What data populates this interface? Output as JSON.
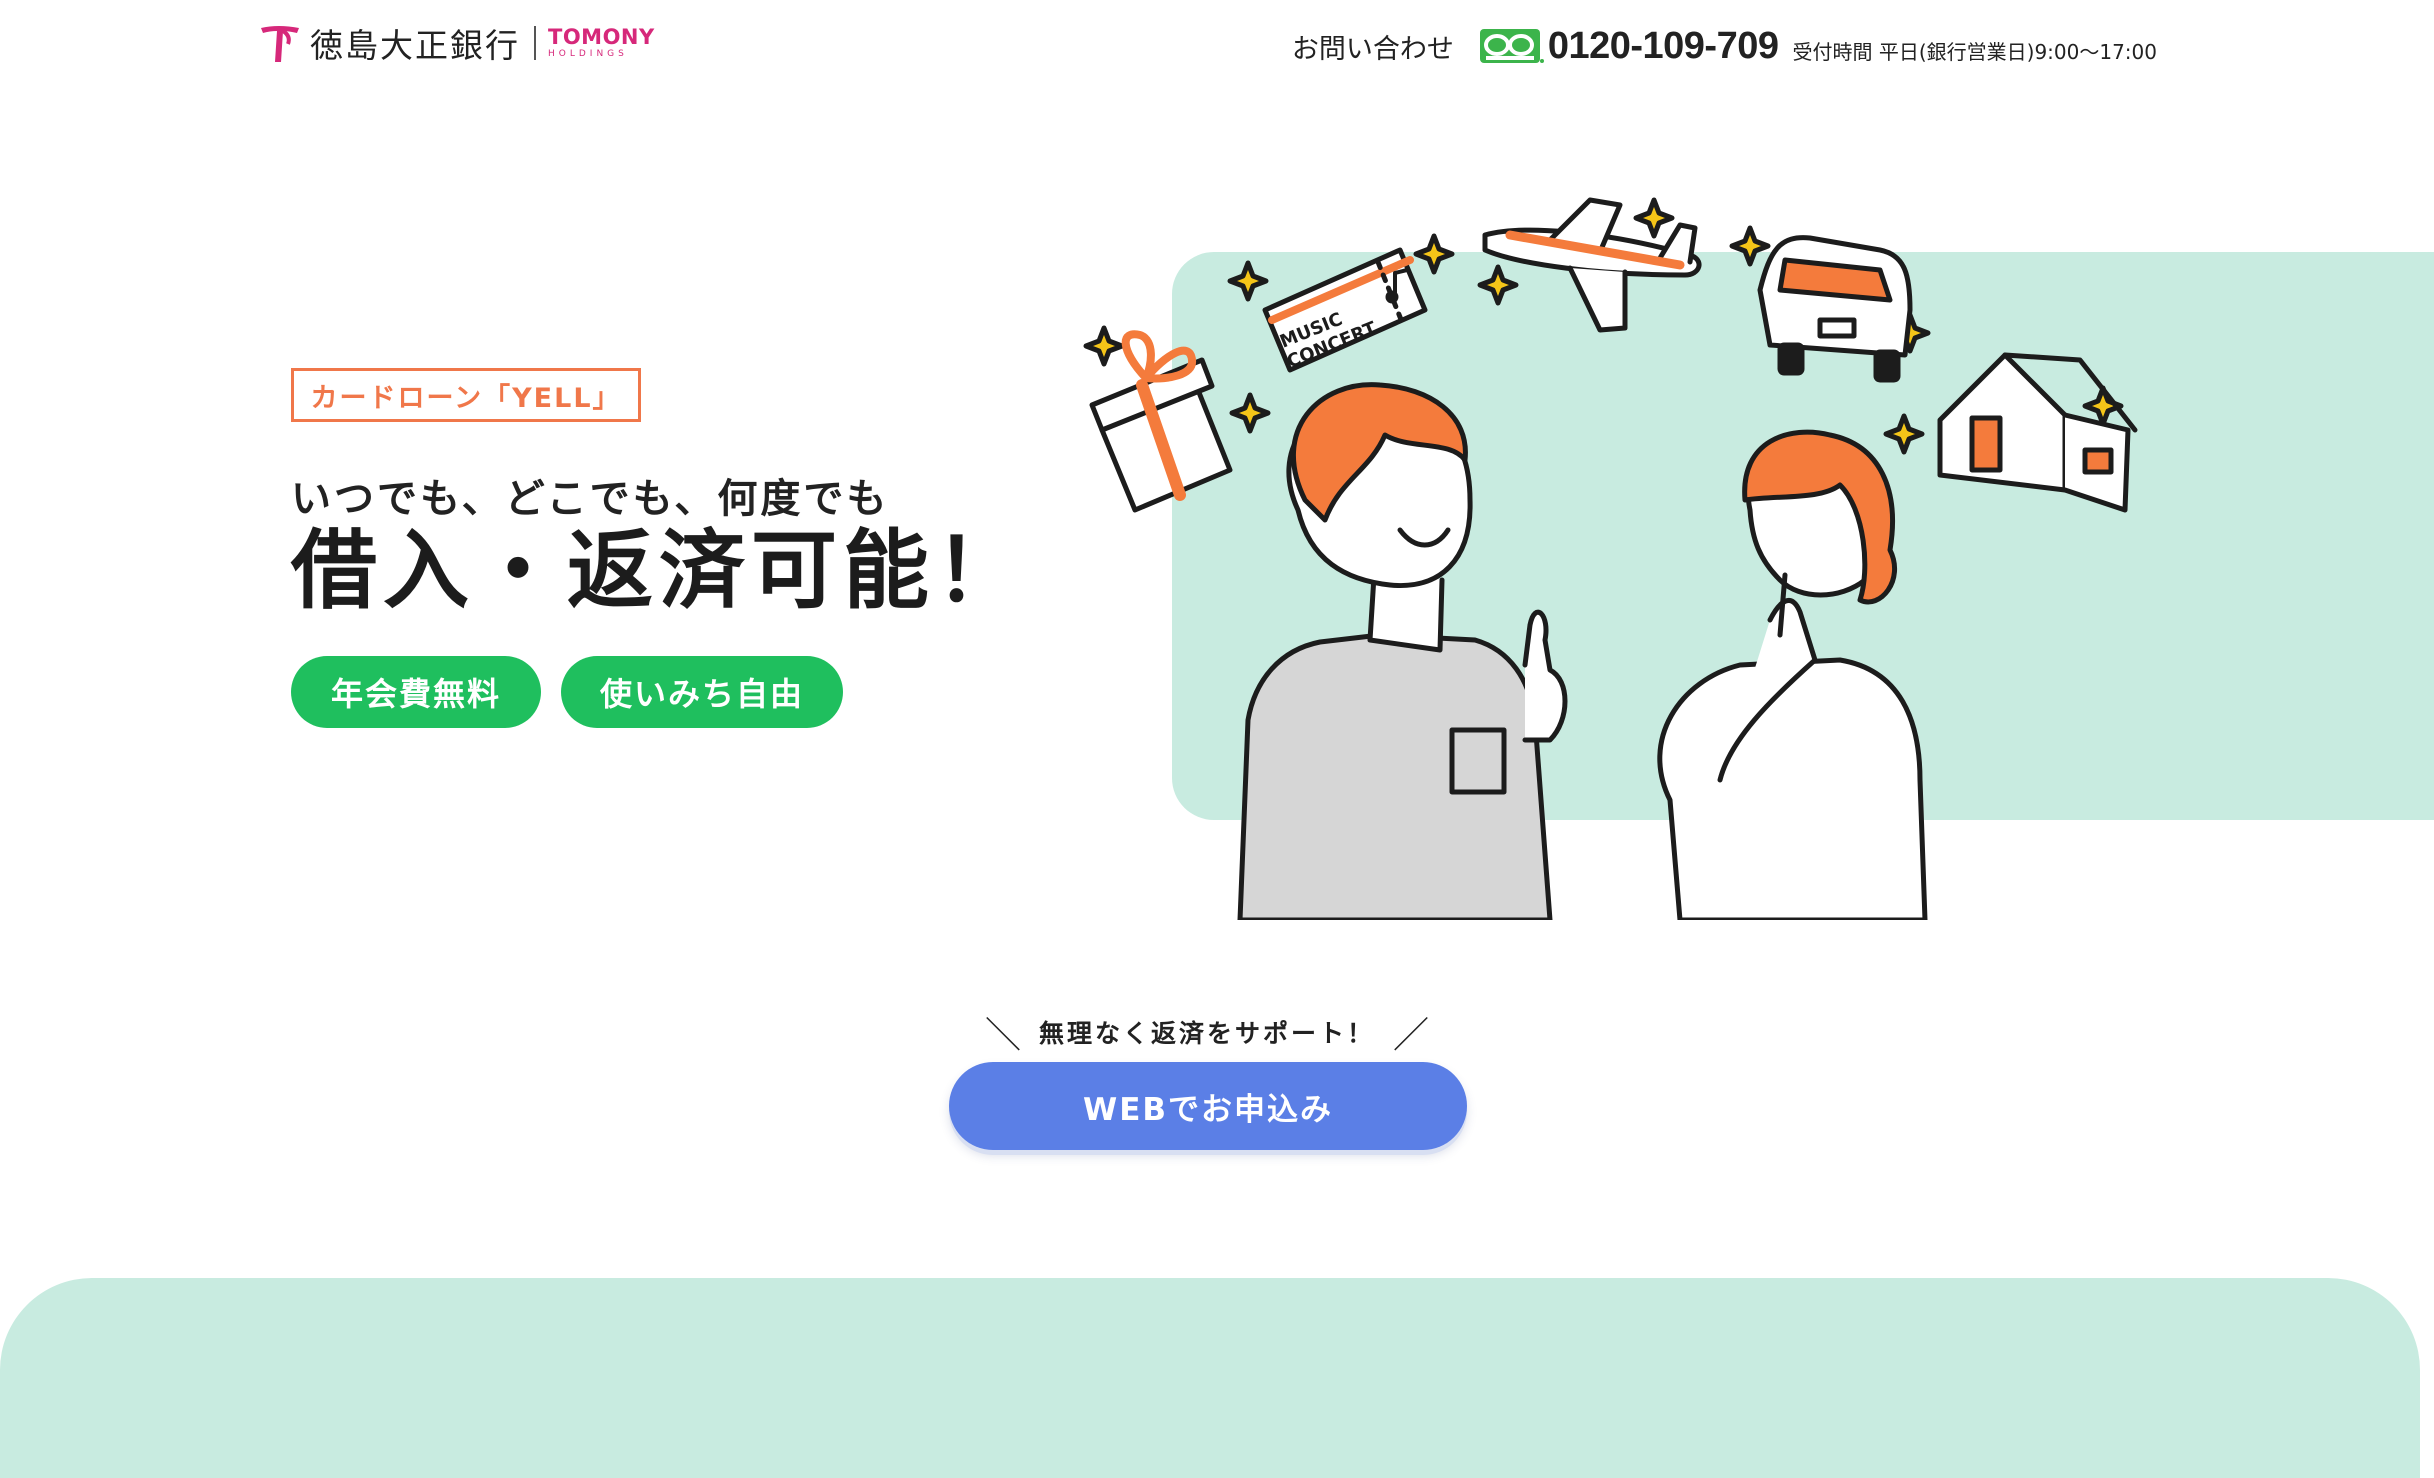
{
  "header": {
    "bank_name": "徳島大正銀行",
    "holdings_brand": "TOMONY",
    "holdings_sub": "HOLDINGS",
    "contact_label": "お問い合わせ",
    "phone": "0120-109-709",
    "hours": "受付時間 平日(銀行営業日)9:00〜17:00"
  },
  "hero": {
    "tag": "カードローン「YELL」",
    "subtitle": "いつでも、どこでも、何度でも",
    "title": "借入・返済可能！",
    "badges": [
      "年会費無料",
      "使いみち自由"
    ],
    "illustration_text": [
      "MUSIC",
      "CONCERT"
    ]
  },
  "cta": {
    "note": "無理なく返済をサポート！",
    "slash_left": "＼",
    "slash_right": "／",
    "button": "WEBでお申込み"
  },
  "colors": {
    "accent_orange": "#f0774a",
    "badge_green": "#1fbf5e",
    "cta_blue": "#5b7fe6",
    "mint": "#c8ebe0",
    "brand_pink": "#d6287a",
    "freedial_green": "#3cb44b"
  },
  "icons": [
    "bank-logo-icon",
    "freedial-icon",
    "gift-icon",
    "concert-ticket-icon",
    "airplane-icon",
    "car-icon",
    "house-icon",
    "sparkle-icon"
  ]
}
